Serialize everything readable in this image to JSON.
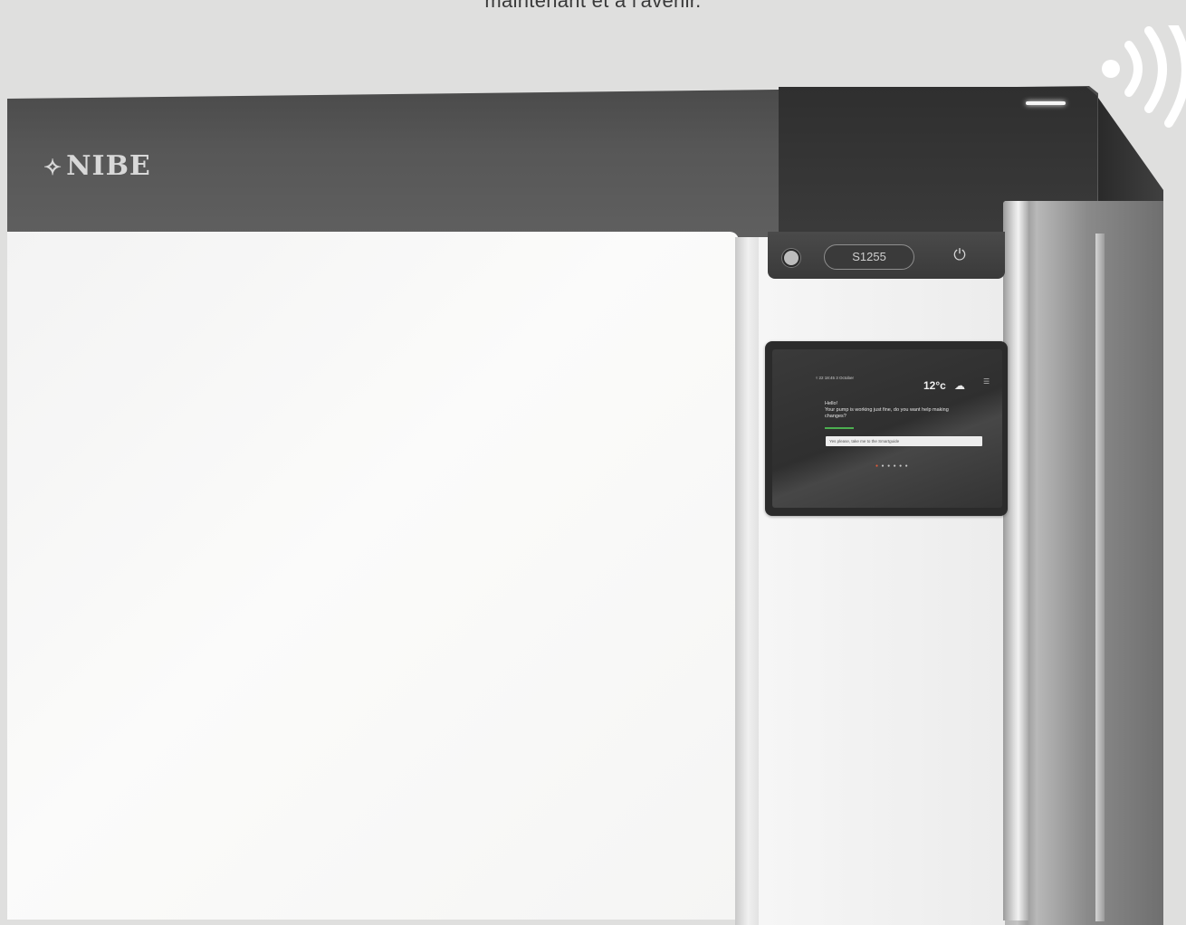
{
  "caption": "maintenant et à l'avenir.",
  "brand": {
    "logo_mark": "✧",
    "logo_text": "NIBE"
  },
  "controls": {
    "model_label": "S1255",
    "power_icon": "power-icon",
    "home_icon": "home-button-icon"
  },
  "display": {
    "status_line": "▿  22   18:45  3 October",
    "temperature": "12°c",
    "weather_icon": "cloud-icon",
    "menu_icon": "menu-icon",
    "greeting": "Hello!",
    "message": "Your pump is working just fine, do you want help making changes?",
    "input_placeholder": "Yes please, take me to the Smartguide",
    "page_dots": 6,
    "active_dot": 0
  },
  "colors": {
    "top_band": "#575757",
    "front_panel": "#f7f7f6",
    "accent_green": "#4caf50",
    "dot_active": "#e45a3a"
  }
}
